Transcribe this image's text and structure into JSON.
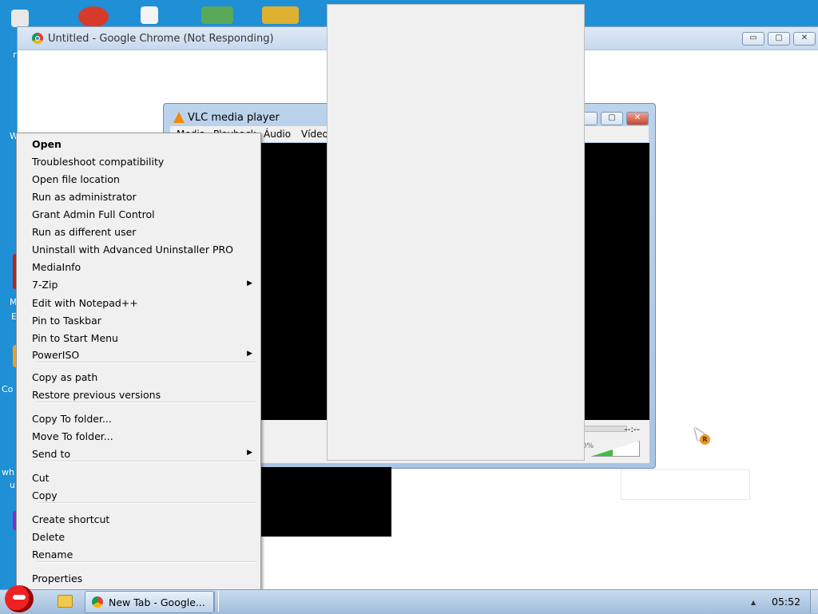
{
  "desktop": {
    "left_labels": [
      "r",
      "W",
      "M",
      "E",
      "Co",
      "wh",
      "u"
    ]
  },
  "chrome": {
    "title": "Untitled - Google Chrome (Not Responding)",
    "buttons": {
      "minimize": "▭",
      "maximize": "▢",
      "close": "✕"
    }
  },
  "vlc": {
    "title": "VLC media player",
    "menu": [
      "Media",
      "Playback",
      "Áudio",
      "Vídeo"
    ],
    "time": "--:--",
    "volume_text": "00%",
    "volume_level": 0.45
  },
  "context_menu": {
    "items": [
      {
        "label": "Open",
        "bold": true
      },
      {
        "label": "Troubleshoot compatibility"
      },
      {
        "label": "Open file location"
      },
      {
        "label": "Run as administrator"
      },
      {
        "label": "Grant Admin Full Control"
      },
      {
        "label": "Run as different user"
      },
      {
        "label": "Uninstall with Advanced Uninstaller PRO"
      },
      {
        "label": "MediaInfo"
      },
      {
        "label": "7-Zip",
        "submenu": true
      },
      {
        "label": "Edit with Notepad++"
      },
      {
        "label": "Pin to Taskbar"
      },
      {
        "label": "Pin to Start Menu"
      },
      {
        "label": "PowerISO",
        "submenu": true
      },
      {
        "label": "Copy as path"
      },
      {
        "label": "Restore previous versions"
      },
      {
        "label": "Copy To folder..."
      },
      {
        "label": "Move To folder..."
      },
      {
        "label": "Send to",
        "submenu": true
      },
      {
        "label": "Cut"
      },
      {
        "label": "Copy"
      },
      {
        "label": "Create shortcut"
      },
      {
        "label": "Delete"
      },
      {
        "label": "Rename"
      },
      {
        "label": "Properties"
      }
    ],
    "submenu_arrow": "▶"
  },
  "cursor_badge": "R",
  "taskbar": {
    "task_label": "New Tab - Google...",
    "tray_arrow": "▲",
    "clock": "05:52"
  }
}
